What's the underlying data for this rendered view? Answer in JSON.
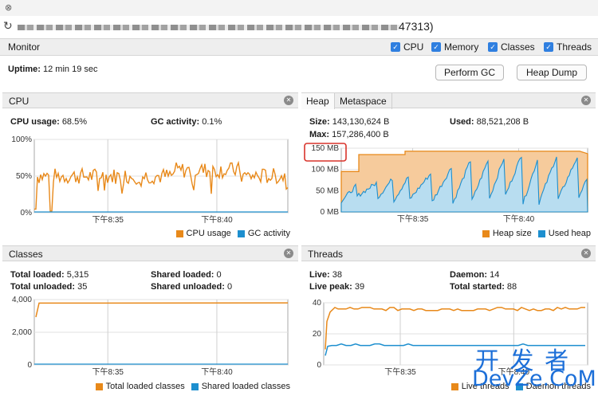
{
  "window": {
    "close_icon": "close-x-icon"
  },
  "process": {
    "name": "47313)"
  },
  "monitor": {
    "label": "Monitor",
    "checkboxes": [
      {
        "label": "CPU",
        "checked": true
      },
      {
        "label": "Memory",
        "checked": true
      },
      {
        "label": "Classes",
        "checked": true
      },
      {
        "label": "Threads",
        "checked": true
      }
    ]
  },
  "uptime": {
    "label": "Uptime:",
    "value": "12 min 19 sec"
  },
  "buttons": {
    "perform_gc": "Perform GC",
    "heap_dump": "Heap Dump"
  },
  "colors": {
    "orange": "#e8891a",
    "blue": "#1d8fcf",
    "highlight": "#d9342b"
  },
  "cpu": {
    "title": "CPU",
    "usage_label": "CPU usage:",
    "usage_value": "68.5%",
    "gc_label": "GC activity:",
    "gc_value": "0.1%",
    "yticks": [
      "100%",
      "50%",
      "0%"
    ],
    "xticks": [
      "下午8:35",
      "下午8:40"
    ],
    "legend": [
      "CPU usage",
      "GC activity"
    ]
  },
  "heap": {
    "tabs": [
      "Heap",
      "Metaspace"
    ],
    "size_label": "Size:",
    "size_value": "143,130,624 B",
    "used_label": "Used:",
    "used_value": "88,521,208 B",
    "max_label": "Max:",
    "max_value": "157,286,400 B",
    "yticks": [
      "150 MB",
      "100 MB",
      "50 MB",
      "0 MB"
    ],
    "xticks": [
      "下午8:35",
      "下午8:40"
    ],
    "legend": [
      "Heap size",
      "Used heap"
    ]
  },
  "classes": {
    "title": "Classes",
    "total_loaded_label": "Total loaded:",
    "total_loaded_value": "5,315",
    "shared_loaded_label": "Shared loaded:",
    "shared_loaded_value": "0",
    "total_unloaded_label": "Total unloaded:",
    "total_unloaded_value": "35",
    "shared_unloaded_label": "Shared unloaded:",
    "shared_unloaded_value": "0",
    "yticks": [
      "4,000",
      "2,000",
      "0"
    ],
    "xticks": [
      "下午8:35",
      "下午8:40"
    ],
    "legend": [
      "Total loaded classes",
      "Shared loaded classes"
    ]
  },
  "threads": {
    "title": "Threads",
    "live_label": "Live:",
    "live_value": "38",
    "daemon_label": "Daemon:",
    "daemon_value": "14",
    "peak_label": "Live peak:",
    "peak_value": "39",
    "started_label": "Total started:",
    "started_value": "88",
    "yticks": [
      "40",
      "20",
      "0"
    ],
    "xticks": [
      "下午8:35",
      "下午8:40"
    ],
    "legend": [
      "Live threads",
      "Daemon threads"
    ]
  },
  "watermark": {
    "cn": "开 发 者",
    "en": "DevZe.CoM"
  }
}
